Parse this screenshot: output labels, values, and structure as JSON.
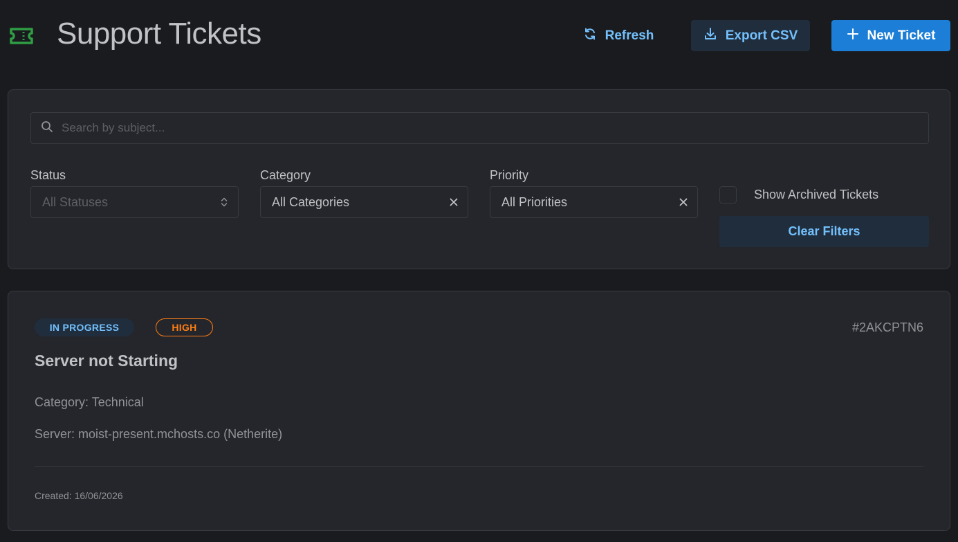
{
  "header": {
    "title": "Support Tickets",
    "logo_icon": "ticket-icon",
    "refresh_label": "Refresh",
    "export_label": "Export CSV",
    "new_ticket_label": "New Ticket"
  },
  "filters": {
    "search_placeholder": "Search by subject...",
    "search_value": "",
    "status": {
      "label": "Status",
      "value": "All Statuses"
    },
    "category": {
      "label": "Category",
      "value": "All Categories"
    },
    "priority": {
      "label": "Priority",
      "value": "All Priorities"
    },
    "show_archived": {
      "label": "Show Archived Tickets",
      "checked": false
    },
    "clear_label": "Clear Filters"
  },
  "tickets": [
    {
      "status": "IN PROGRESS",
      "priority": "HIGH",
      "id": "#2AKCPTN6",
      "subject": "Server not Starting",
      "category_line": "Category: Technical",
      "server_line": "Server: moist-present.mchosts.co (Netherite)",
      "created_line": "Created: 16/06/2026"
    }
  ],
  "colors": {
    "background": "#1a1b1e",
    "panel": "#25262b",
    "accent": "#1c7ed6",
    "accent_light": "#74c0fc",
    "logo": "#2f9e44",
    "priority_high": "#fd7e14"
  }
}
